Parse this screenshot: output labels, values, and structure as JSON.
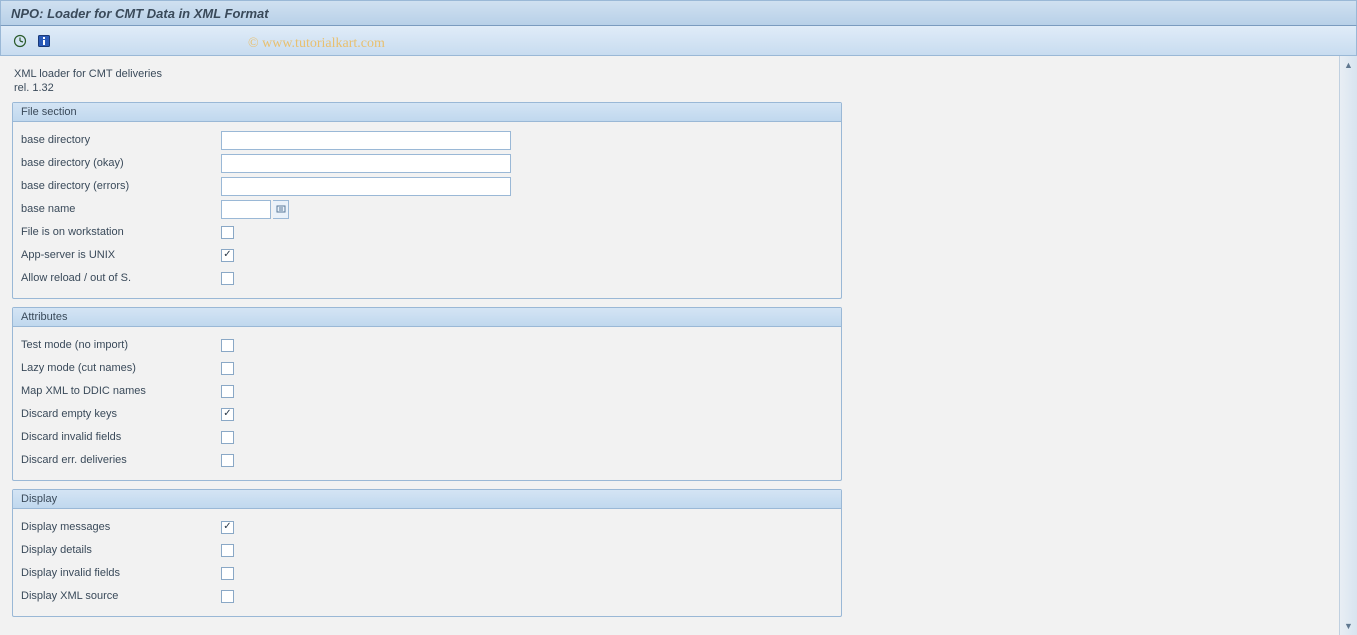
{
  "title": "NPO: Loader for CMT Data in XML Format",
  "watermark": "© www.tutorialkart.com",
  "info": {
    "line1": "XML loader for CMT deliveries",
    "line2": "rel. 1.32"
  },
  "groups": {
    "file": {
      "title": "File section",
      "base_dir_label": "base directory",
      "base_dir_value": "",
      "base_dir_ok_label": "base directory (okay)",
      "base_dir_ok_value": "",
      "base_dir_err_label": "base directory (errors)",
      "base_dir_err_value": "",
      "base_name_label": "base name",
      "base_name_value": "",
      "file_ws_label": "File is on workstation",
      "file_ws_checked": false,
      "unix_label": "App-server is UNIX",
      "unix_checked": true,
      "reload_label": "Allow reload / out of S.",
      "reload_checked": false
    },
    "attr": {
      "title": "Attributes",
      "test_label": "Test mode (no import)",
      "test_checked": false,
      "lazy_label": "Lazy mode (cut names)",
      "lazy_checked": false,
      "map_label": "Map XML to DDIC names",
      "map_checked": false,
      "discard_empty_label": "Discard empty keys",
      "discard_empty_checked": true,
      "discard_invalid_label": "Discard invalid fields",
      "discard_invalid_checked": false,
      "discard_err_label": "Discard err. deliveries",
      "discard_err_checked": false
    },
    "display": {
      "title": "Display",
      "msg_label": "Display messages",
      "msg_checked": true,
      "details_label": "Display details",
      "details_checked": false,
      "invalid_label": "Display invalid fields",
      "invalid_checked": false,
      "xml_label": "Display XML source",
      "xml_checked": false
    }
  }
}
